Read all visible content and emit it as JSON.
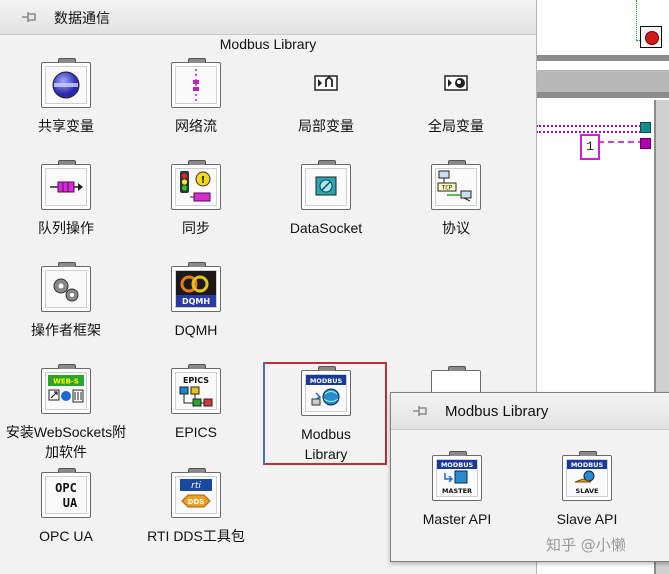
{
  "palette": {
    "title": "数据通信",
    "subtitle": "Modbus Library",
    "items": [
      {
        "label": "共享变量"
      },
      {
        "label": "网络流"
      },
      {
        "label": "局部变量"
      },
      {
        "label": "全局变量"
      },
      {
        "label": "队列操作"
      },
      {
        "label": "同步"
      },
      {
        "label": "DataSocket"
      },
      {
        "label": "协议"
      },
      {
        "label": "操作者框架"
      },
      {
        "label": "DQMH"
      },
      {
        "label": "安装WebSockets附加软件"
      },
      {
        "label": "EPICS"
      },
      {
        "label": "Modbus Library"
      },
      {
        "label": "OPC UA"
      },
      {
        "label": "RTI DDS工具包"
      }
    ],
    "icon_text": {
      "dqmh": "DQMH",
      "web_s": "WEB-S",
      "tcp": "TCP",
      "epics": "EPICS",
      "modbus": "MODBUS",
      "opc": "OPC",
      "ua": "UA",
      "rti": "rti",
      "dds": "DDS"
    }
  },
  "popup": {
    "title": "Modbus Library",
    "items": [
      {
        "label": "Master API",
        "icon_top": "MODBUS",
        "icon_bottom": "MASTER"
      },
      {
        "label": "Slave API",
        "icon_top": "MODBUS",
        "icon_bottom": "SLAVE"
      }
    ]
  },
  "diagram": {
    "constant": "1"
  },
  "watermark": "知乎 @小懒",
  "colors": {
    "selection_border": "#c42d3a",
    "wire_pink": "#b000b0",
    "stop_red": "#d21a1a"
  }
}
